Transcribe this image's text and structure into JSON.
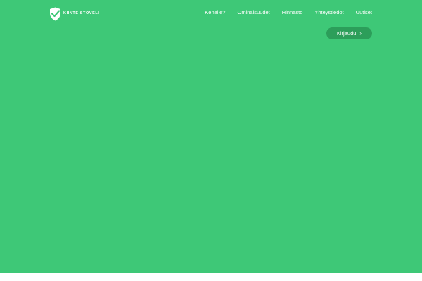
{
  "header": {
    "logo_text": "KIINTEISTÖVELI",
    "logo_icon": "shield-check-icon",
    "nav": [
      {
        "label": "Kenelle?"
      },
      {
        "label": "Ominaisuudet"
      },
      {
        "label": "Hinnasto"
      },
      {
        "label": "Yhteystiedot"
      },
      {
        "label": "Uutiset"
      }
    ],
    "login": {
      "label": "Kirjaudu",
      "icon": "chevron-right-icon"
    }
  },
  "colors": {
    "hero_background": "#3ec877",
    "button_background": "#2c9e5a",
    "text": "#ffffff"
  }
}
